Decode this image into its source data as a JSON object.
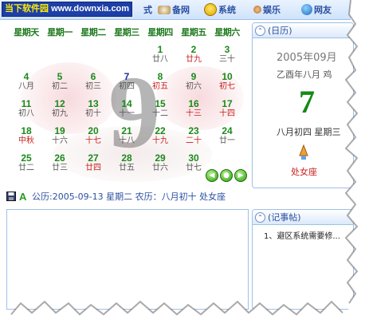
{
  "toolbar": {
    "brand_name": "当下软件园",
    "brand_url": "www.downxia.com",
    "items": [
      "式",
      "备网",
      "系统",
      "娱乐",
      "网友"
    ]
  },
  "calendar": {
    "weekdays": [
      "星期天",
      "星期一",
      "星期二",
      "星期三",
      "星期四",
      "星期五",
      "星期六"
    ],
    "watermark_day": "9",
    "rows": [
      [
        {
          "g": "",
          "l": ""
        },
        {
          "g": "",
          "l": ""
        },
        {
          "g": "",
          "l": ""
        },
        {
          "g": "",
          "l": ""
        },
        {
          "g": "1",
          "l": "廿八"
        },
        {
          "g": "2",
          "l": "廿九",
          "red": true
        },
        {
          "g": "3",
          "l": "三十"
        }
      ],
      [
        {
          "g": "4",
          "l": "八月"
        },
        {
          "g": "5",
          "l": "初二"
        },
        {
          "g": "6",
          "l": "初三"
        },
        {
          "g": "7",
          "l": "初四",
          "today": true
        },
        {
          "g": "8",
          "l": "初五",
          "red": true
        },
        {
          "g": "9",
          "l": "初六"
        },
        {
          "g": "10",
          "l": "初七",
          "red": true
        }
      ],
      [
        {
          "g": "11",
          "l": "初八"
        },
        {
          "g": "12",
          "l": "初九"
        },
        {
          "g": "13",
          "l": "初十"
        },
        {
          "g": "14",
          "l": "十一"
        },
        {
          "g": "15",
          "l": "十二"
        },
        {
          "g": "16",
          "l": "十三",
          "red": true
        },
        {
          "g": "17",
          "l": "十四",
          "red": true
        }
      ],
      [
        {
          "g": "18",
          "l": "中秋",
          "red": true
        },
        {
          "g": "19",
          "l": "十六"
        },
        {
          "g": "20",
          "l": "十七",
          "red": true
        },
        {
          "g": "21",
          "l": "十八"
        },
        {
          "g": "22",
          "l": "十九",
          "red": true
        },
        {
          "g": "23",
          "l": "二十",
          "red": true
        },
        {
          "g": "24",
          "l": "廿一"
        }
      ],
      [
        {
          "g": "25",
          "l": "廿二"
        },
        {
          "g": "26",
          "l": "廿三"
        },
        {
          "g": "27",
          "l": "廿四",
          "red": true
        },
        {
          "g": "28",
          "l": "廿五"
        },
        {
          "g": "29",
          "l": "廿六"
        },
        {
          "g": "30",
          "l": "廿七"
        },
        {
          "g": "",
          "l": ""
        }
      ]
    ],
    "nav": [
      "◀",
      "●",
      "▶"
    ]
  },
  "day_panel": {
    "title": "(日历)",
    "year_month": "2005年09月",
    "lunar_year": "乙酉年八月 鸡",
    "day": "7",
    "lunar_day": "八月初四 星期三",
    "zodiac": "处女座"
  },
  "status": {
    "text": "公历:2005-09-13 星期二 农历：八月初十 处女座"
  },
  "notes": {
    "title": "(记事帖)",
    "line": "1、避区系统需要修..."
  },
  "colors": {
    "accent_blue": "#2b4fa0",
    "day_green": "#1a8a1a",
    "festival_red": "#c8201c"
  }
}
